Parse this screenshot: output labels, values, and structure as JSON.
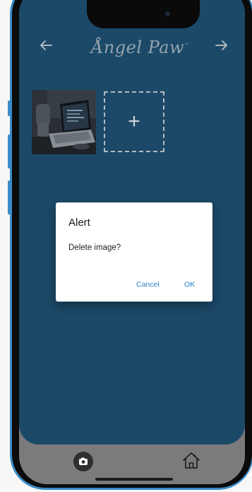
{
  "header": {
    "logo_text": "Ångel Paw",
    "logo_mark": "™",
    "back_icon": "arrow-left-icon",
    "forward_icon": "arrow-right-icon"
  },
  "gallery": {
    "images": [
      {
        "icon": "laptop-photo"
      }
    ],
    "add_label": "+"
  },
  "alert": {
    "title": "Alert",
    "message": "Delete image?",
    "cancel_label": "Cancel",
    "ok_label": "OK"
  },
  "tabbar": {
    "camera_icon": "camera-icon",
    "home_icon": "home-icon"
  },
  "colors": {
    "app_background": "#1e4d6d",
    "accent": "#2a7fc0",
    "tabbar": "#808080",
    "phone_frame": "#3a8cc9"
  }
}
